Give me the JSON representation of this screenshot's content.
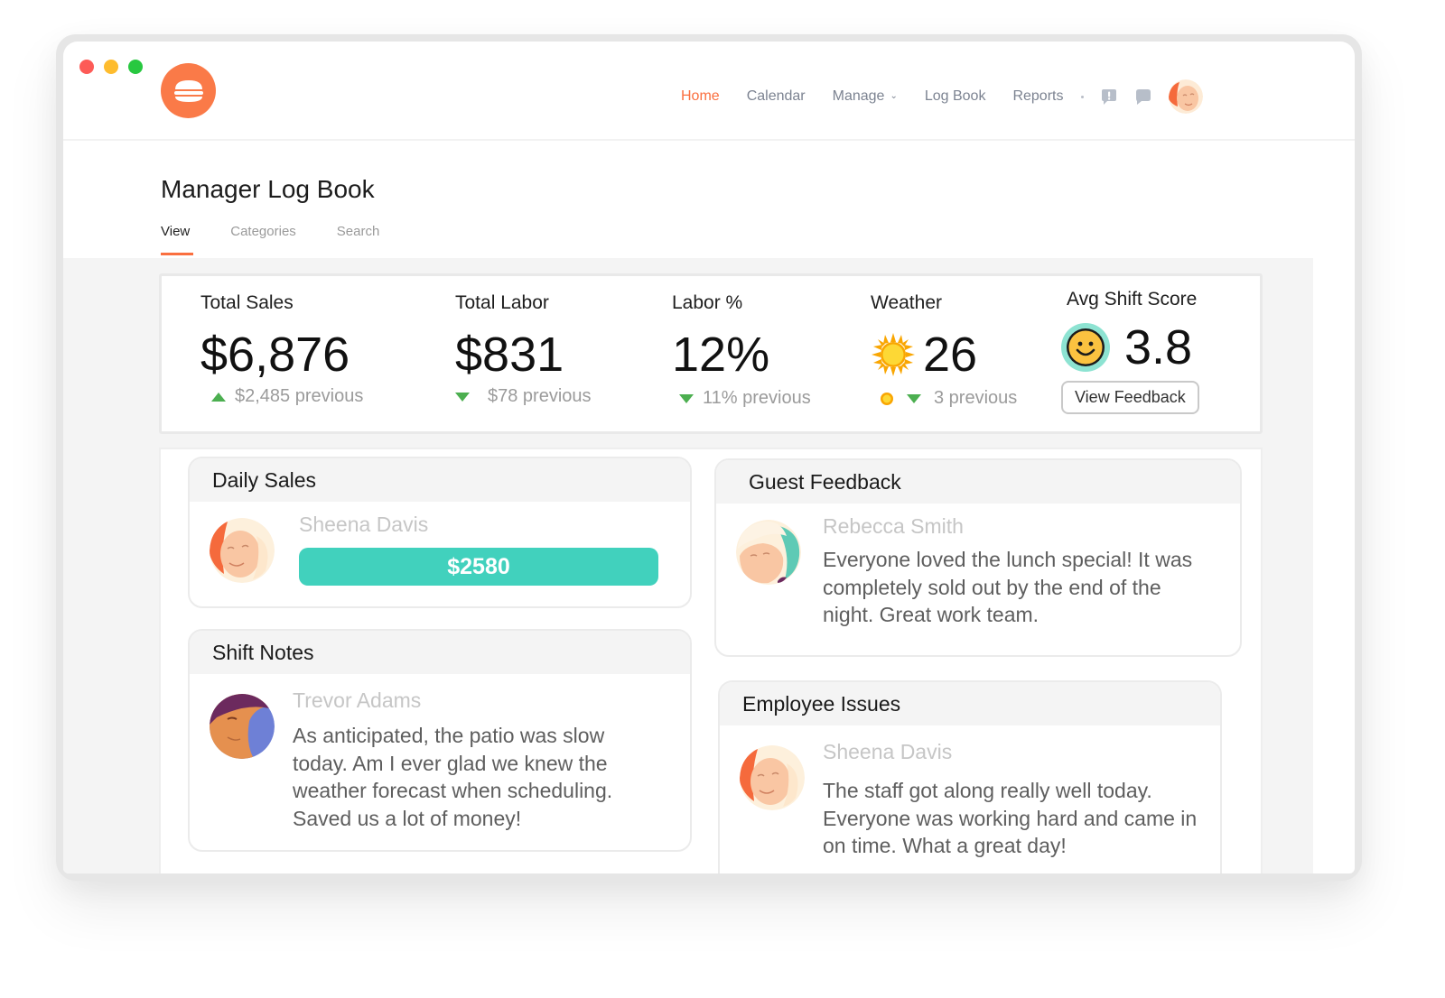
{
  "window": {
    "controls": [
      "close",
      "minimize",
      "maximize"
    ],
    "logo_icon": "burger-icon"
  },
  "nav": {
    "items": [
      {
        "label": "Home",
        "active": true
      },
      {
        "label": "Calendar",
        "active": false
      },
      {
        "label": "Manage",
        "active": false,
        "dropdown": true
      },
      {
        "label": "Log Book",
        "active": false
      },
      {
        "label": "Reports",
        "active": false
      }
    ],
    "icons": [
      "alert-icon",
      "chat-icon"
    ],
    "chevron": "⌄",
    "accent_color": "#fa6f3f"
  },
  "page": {
    "title": "Manager Log Book",
    "tabs": [
      {
        "label": "View",
        "active": true
      },
      {
        "label": "Categories",
        "active": false
      },
      {
        "label": "Search",
        "active": false
      }
    ]
  },
  "stats": {
    "total_sales": {
      "label": "Total Sales",
      "value": "$6,876",
      "previous": "$2,485 previous",
      "trend": "up"
    },
    "total_labor": {
      "label": "Total Labor",
      "value": "$831",
      "previous": "$78 previous",
      "trend": "down"
    },
    "labor_pct": {
      "label": "Labor %",
      "value": "12%",
      "previous": "11% previous",
      "trend": "down"
    },
    "weather": {
      "label": "Weather",
      "value": "26",
      "previous": "3 previous",
      "trend": "down",
      "icon": "sun-icon"
    },
    "shift_score": {
      "label": "Avg Shift Score",
      "value": "3.8",
      "icon": "smiley-icon",
      "button": "View Feedback"
    },
    "trend_color": "#4caf50"
  },
  "cards": {
    "daily_sales": {
      "title": "Daily Sales",
      "name": "Sheena Davis",
      "amount": "$2580"
    },
    "shift_notes": {
      "title": "Shift Notes",
      "name": "Trevor Adams",
      "message": "As anticipated, the patio was slow today. Am I ever glad we knew the weather forecast when scheduling. Saved us a lot of money!"
    },
    "guest_feedback": {
      "title": "Guest Feedback",
      "name": "Rebecca Smith",
      "message": "Everyone loved the lunch special! It was completely sold out by the end of the night. Great work team."
    },
    "employee_issues": {
      "title": "Employee Issues",
      "name": "Sheena Davis",
      "message": "The staff got along really well today. Everyone was working hard and came in on time. What a great day!"
    }
  }
}
